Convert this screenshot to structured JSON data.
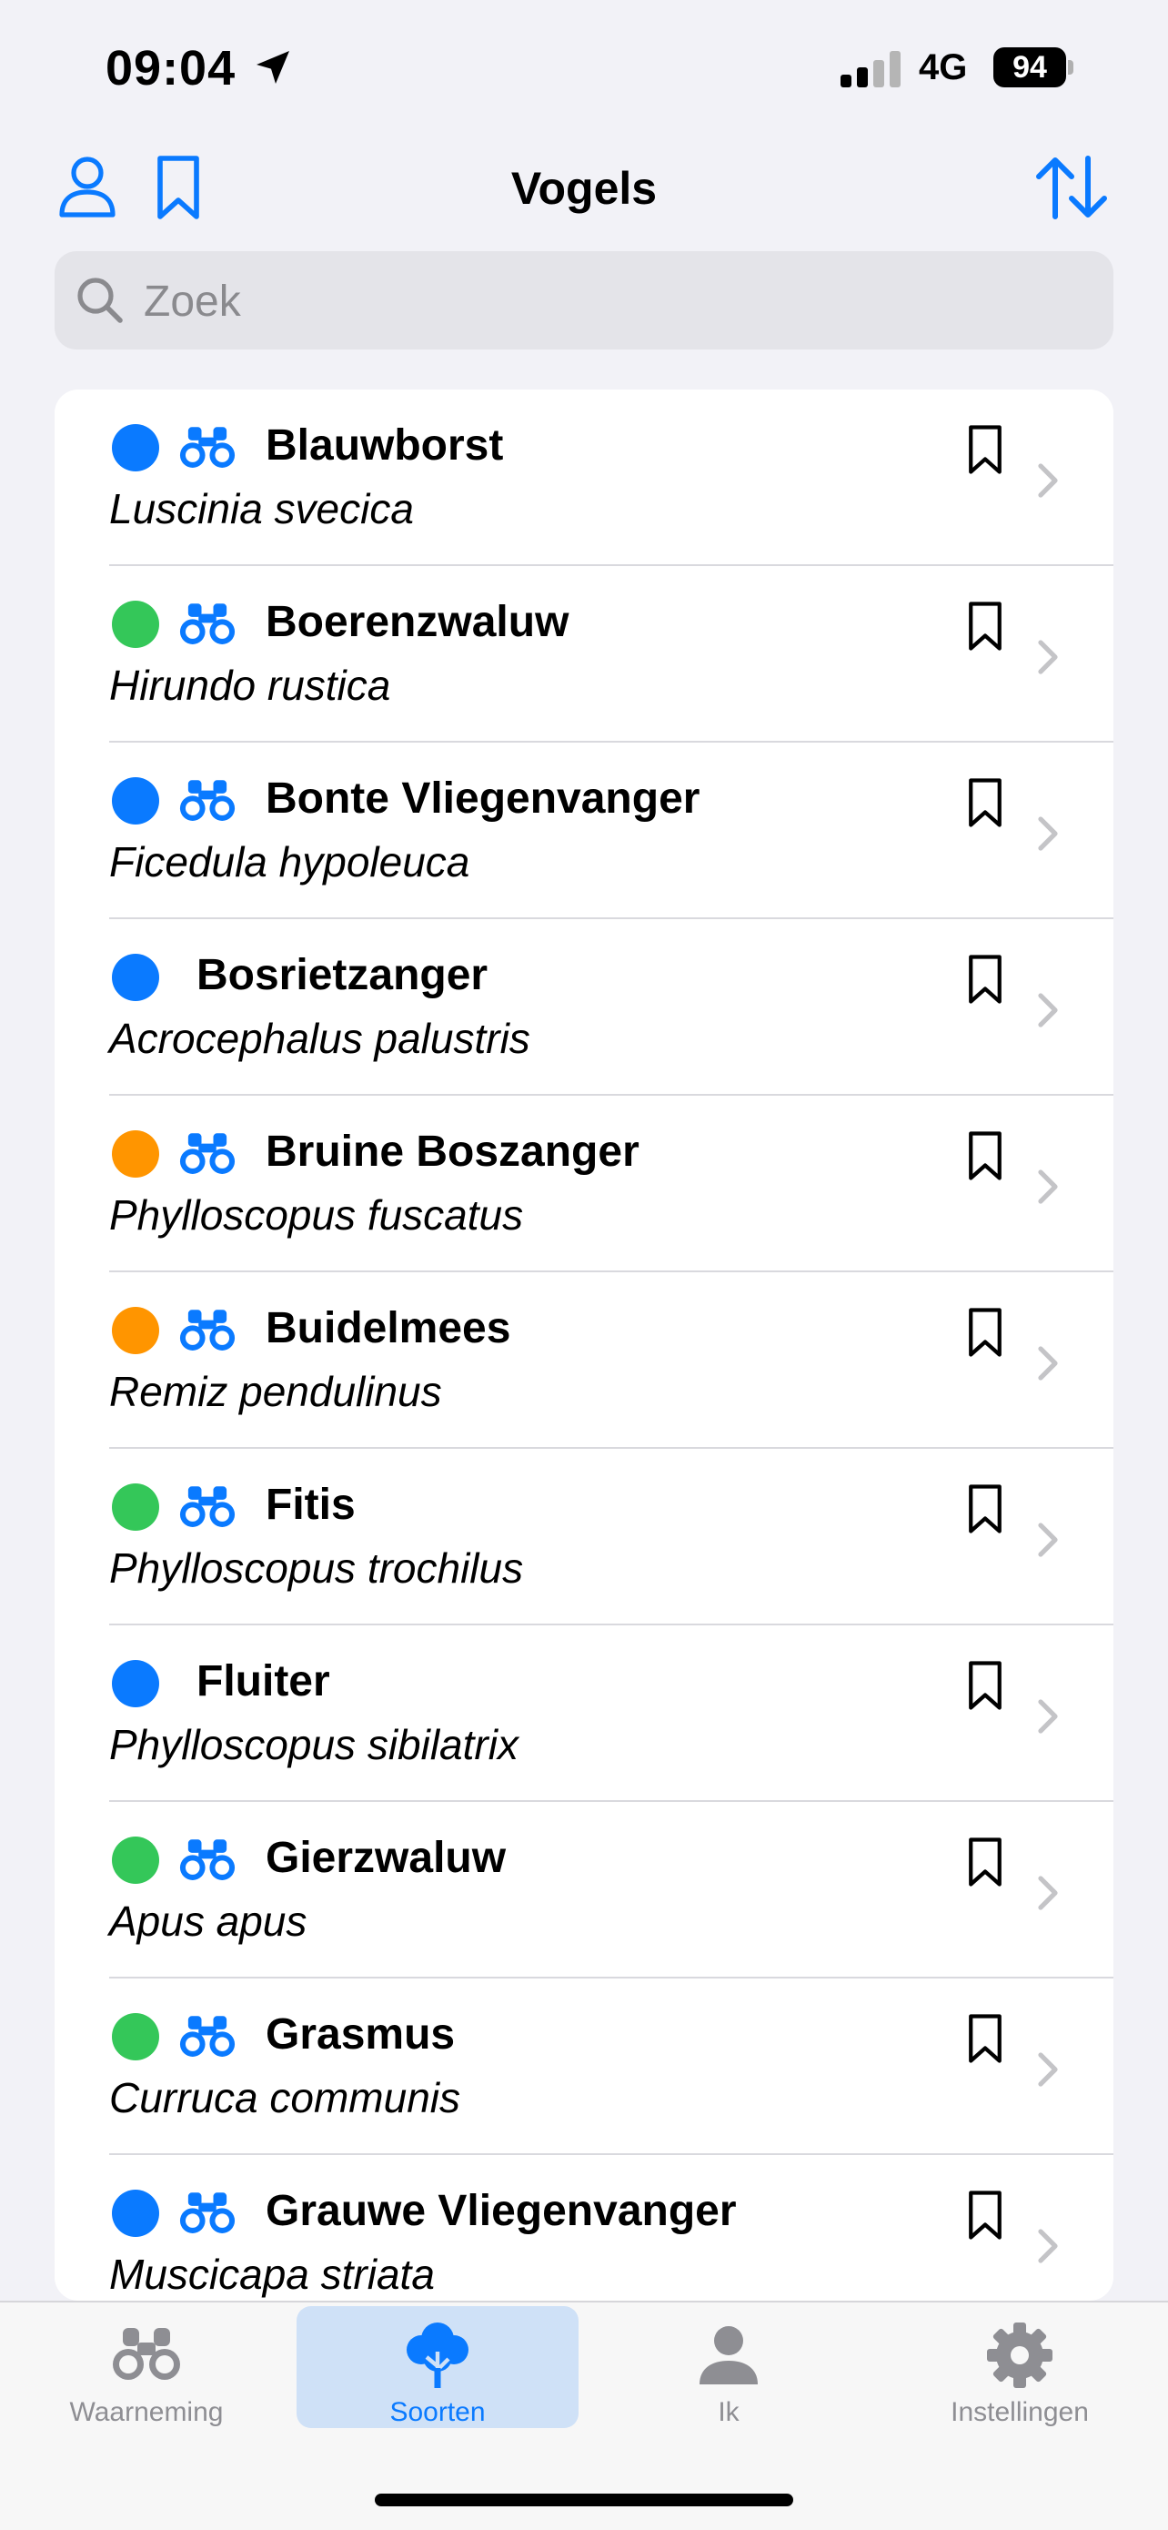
{
  "status_bar": {
    "time": "09:04",
    "network": "4G",
    "battery": "94"
  },
  "nav": {
    "title": "Vogels"
  },
  "search": {
    "placeholder": "Zoek"
  },
  "colors": {
    "accent": "#0a7aff",
    "blue": "#0a7aff",
    "green": "#34c759",
    "orange": "#ff9500"
  },
  "species": [
    {
      "common": "Blauwborst",
      "scientific": "Luscinia svecica",
      "status": "blue",
      "binoculars": true
    },
    {
      "common": "Boerenzwaluw",
      "scientific": "Hirundo rustica",
      "status": "green",
      "binoculars": true
    },
    {
      "common": "Bonte Vliegenvanger",
      "scientific": "Ficedula hypoleuca",
      "status": "blue",
      "binoculars": true
    },
    {
      "common": "Bosrietzanger",
      "scientific": "Acrocephalus palustris",
      "status": "blue",
      "binoculars": false
    },
    {
      "common": "Bruine Boszanger",
      "scientific": "Phylloscopus fuscatus",
      "status": "orange",
      "binoculars": true
    },
    {
      "common": "Buidelmees",
      "scientific": "Remiz pendulinus",
      "status": "orange",
      "binoculars": true
    },
    {
      "common": "Fitis",
      "scientific": "Phylloscopus trochilus",
      "status": "green",
      "binoculars": true
    },
    {
      "common": "Fluiter",
      "scientific": "Phylloscopus sibilatrix",
      "status": "blue",
      "binoculars": false
    },
    {
      "common": "Gierzwaluw",
      "scientific": "Apus apus",
      "status": "green",
      "binoculars": true
    },
    {
      "common": "Grasmus",
      "scientific": "Curruca communis",
      "status": "green",
      "binoculars": true
    },
    {
      "common": "Grauwe Vliegenvanger",
      "scientific": "Muscicapa striata",
      "status": "blue",
      "binoculars": true
    }
  ],
  "tabs": [
    {
      "label": "Waarneming",
      "icon": "binoculars-icon",
      "active": false
    },
    {
      "label": "Soorten",
      "icon": "tree-icon",
      "active": true
    },
    {
      "label": "Ik",
      "icon": "person-icon",
      "active": false
    },
    {
      "label": "Instellingen",
      "icon": "gear-icon",
      "active": false
    }
  ]
}
